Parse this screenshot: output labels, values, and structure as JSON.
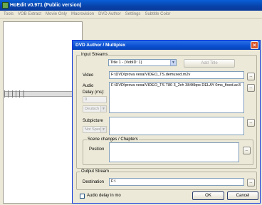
{
  "app": {
    "title": "HoEdit v0.971 (Public version)",
    "menu": [
      "Tools",
      "VOB Extract",
      "Movie Only",
      "Macrovision",
      "DVD Author",
      "Settings",
      "Subtitle Color"
    ]
  },
  "dialog": {
    "title": "DVD Author / Multiplex",
    "close": "×",
    "input_streams": {
      "group_label": "Input Streams",
      "title_select": "Title 1 - (VobID: 1)",
      "add_title": "Add Title",
      "video_label": "Video",
      "video_value": "F:\\DVD\\prova vexa\\VIDEO_TS.demuxed.m2v",
      "audio_label": "Audio",
      "audio_value": "F:\\DVD\\prova vexa\\VIDEO_TS T80 3_2ch 384Kbps DELAY 0ms_fixed.ac3",
      "delay_label": "Delay (ms):",
      "delay_value": "0",
      "audio_lang": "Deutsch",
      "subpicture_label": "Subpicture",
      "subpicture_lang": "Not Specifi",
      "browse": "..."
    },
    "chapters": {
      "group_label": "Scene changes / Chapters",
      "position_label": "Position"
    },
    "output": {
      "group_label": "Output Stream",
      "destination_label": "Destination",
      "destination_value": "F:\\"
    },
    "audio_delay_checkbox": "Audio delay in mo",
    "ok": "OK",
    "cancel": "Cancel"
  }
}
